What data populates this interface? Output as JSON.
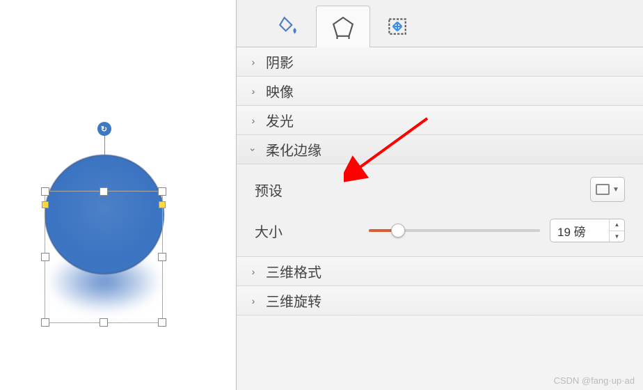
{
  "tabs": {
    "fill": "fill-tab",
    "shape": "shape-tab",
    "size": "size-tab",
    "active": "shape"
  },
  "accordion": {
    "shadow": {
      "label": "阴影",
      "expanded": false
    },
    "reflection": {
      "label": "映像",
      "expanded": false
    },
    "glow": {
      "label": "发光",
      "expanded": false
    },
    "soft_edges": {
      "label": "柔化边缘",
      "expanded": true
    },
    "format_3d": {
      "label": "三维格式",
      "expanded": false
    },
    "rotate_3d": {
      "label": "三维旋转",
      "expanded": false
    }
  },
  "soft_edges": {
    "preset_label": "预设",
    "size_label": "大小",
    "size_value": "19 磅",
    "size_percent": 17
  },
  "shape": {
    "color": "#3f78c4"
  },
  "watermark": "CSDN @fang·up·ad"
}
